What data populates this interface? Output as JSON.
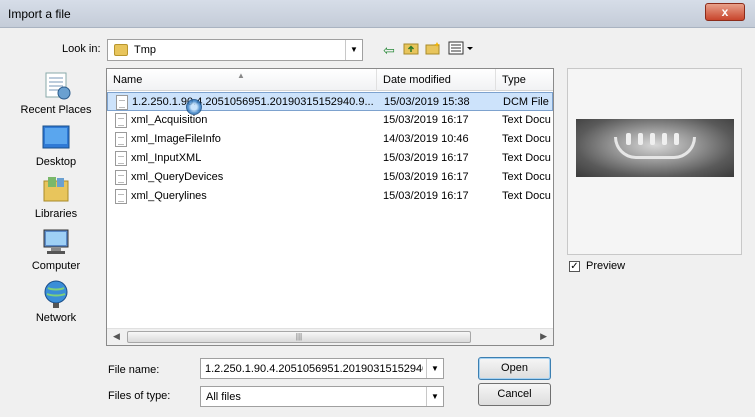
{
  "window": {
    "title": "Import a file",
    "close_label": "x"
  },
  "toolbar": {
    "lookin_label": "Look in:",
    "lookin_value": "Tmp",
    "back_icon": "back-arrow-icon",
    "up_icon": "up-folder-icon",
    "new_folder_icon": "new-folder-icon",
    "view_icon": "view-menu-icon"
  },
  "places": [
    {
      "label": "Recent Places",
      "icon": "recent-places-icon"
    },
    {
      "label": "Desktop",
      "icon": "desktop-icon"
    },
    {
      "label": "Libraries",
      "icon": "libraries-icon"
    },
    {
      "label": "Computer",
      "icon": "computer-icon"
    },
    {
      "label": "Network",
      "icon": "network-icon"
    }
  ],
  "filelist": {
    "columns": [
      "Name",
      "Date modified",
      "Type"
    ],
    "rows": [
      {
        "name": "1.2.250.1.90.4.2051056951.20190315152940.9...",
        "date": "15/03/2019 15:38",
        "type": "DCM File",
        "selected": true
      },
      {
        "name": "xml_Acquisition",
        "date": "15/03/2019 16:17",
        "type": "Text Docu"
      },
      {
        "name": "xml_ImageFileInfo",
        "date": "14/03/2019 10:46",
        "type": "Text Docu"
      },
      {
        "name": "xml_InputXML",
        "date": "15/03/2019 16:17",
        "type": "Text Docu"
      },
      {
        "name": "xml_QueryDevices",
        "date": "15/03/2019 16:17",
        "type": "Text Docu"
      },
      {
        "name": "xml_Querylines",
        "date": "15/03/2019 16:17",
        "type": "Text Docu"
      }
    ]
  },
  "preview": {
    "checkbox_label": "Preview",
    "checked": true
  },
  "footer": {
    "file_name_label": "File name:",
    "file_name_value": "1.2.250.1.90.4.2051056951.20190315152940.9",
    "files_of_type_label": "Files of type:",
    "files_of_type_value": "All files",
    "open_label": "Open",
    "cancel_label": "Cancel"
  }
}
